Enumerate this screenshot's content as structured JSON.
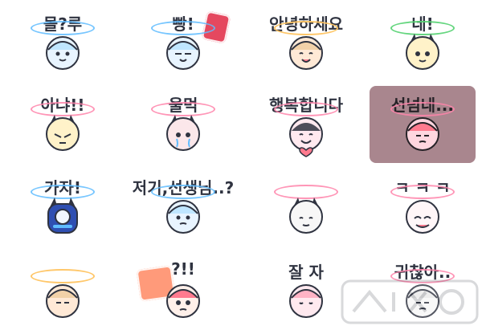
{
  "stickers": [
    {
      "caption": "몰?루"
    },
    {
      "caption": "빵!"
    },
    {
      "caption": "안녕하세요"
    },
    {
      "caption": "네!"
    },
    {
      "caption": "아냐!!"
    },
    {
      "caption": "울먹"
    },
    {
      "caption": "행복합니다"
    },
    {
      "caption": "선넘네..."
    },
    {
      "caption": "가자!"
    },
    {
      "caption": "저기,선생님..?"
    },
    {
      "caption": ""
    },
    {
      "caption": "ㅋ ㅋ ㅋ"
    },
    {
      "caption": ""
    },
    {
      "caption": "?!!"
    },
    {
      "caption": "잘 자"
    },
    {
      "caption": "귀찮아.."
    }
  ],
  "selected_index": 7,
  "icons": {
    "sticker_art": "chibi-character-icon",
    "watermark": "watermark-icon"
  },
  "colors": {
    "selected_tile": "#a9868e",
    "halo_blue": "#5fbcff",
    "halo_pink": "#ff84aa",
    "halo_yellow": "#ffc462",
    "halo_green": "#54d271",
    "accent_red": "#e5485f"
  }
}
